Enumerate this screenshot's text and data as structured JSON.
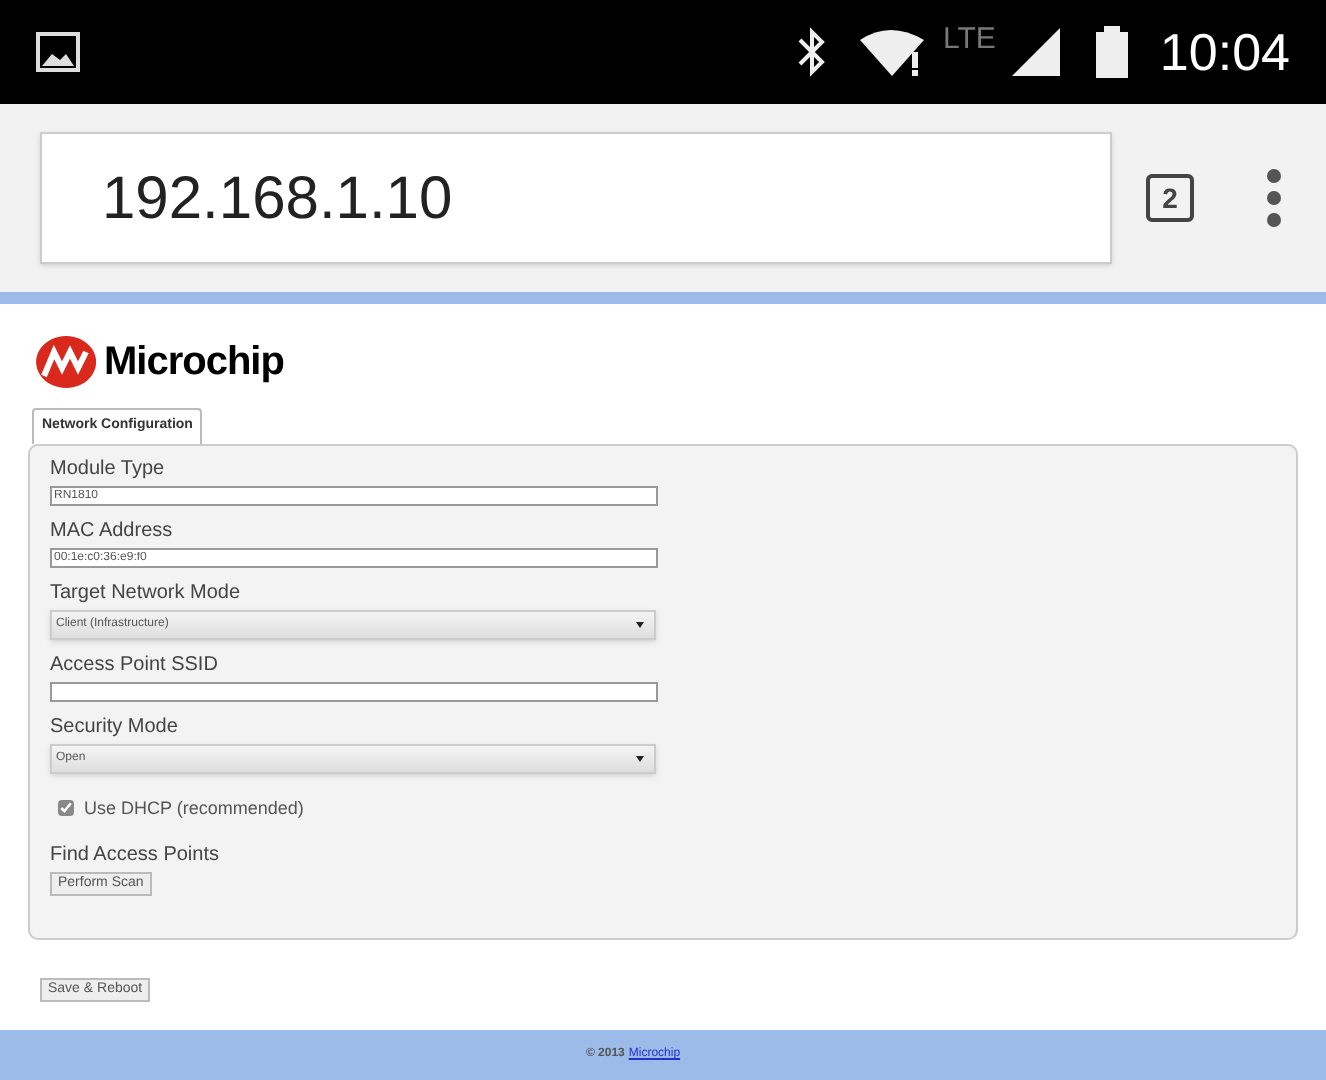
{
  "status_bar": {
    "time": "10:04",
    "network": "LTE"
  },
  "browser": {
    "url": "192.168.1.10",
    "tab_count": "2"
  },
  "logo": {
    "text": "Microchip"
  },
  "tabs": [
    {
      "label": "Network Configuration",
      "selected": true
    }
  ],
  "fields": [
    {
      "kind": "text",
      "label": "Module Type",
      "value": "RN1810"
    },
    {
      "kind": "text",
      "label": "MAC Address",
      "value": "00:1e:c0:36:e9:f0"
    },
    {
      "kind": "select",
      "label": "Target Network Mode",
      "value": "Client (Infrastructure)"
    },
    {
      "kind": "text",
      "label": "Access Point SSID"
    },
    {
      "kind": "select",
      "label": "Security Mode",
      "value": "Open"
    },
    {
      "kind": "checkbox",
      "label": "Use DHCP (recommended)",
      "checked": true
    },
    {
      "kind": "button",
      "label": "Find Access Points",
      "button": "Perform Scan"
    }
  ],
  "save_button": "Save & Reboot",
  "footer": {
    "copyright": "© 2013",
    "link": "Microchip"
  }
}
